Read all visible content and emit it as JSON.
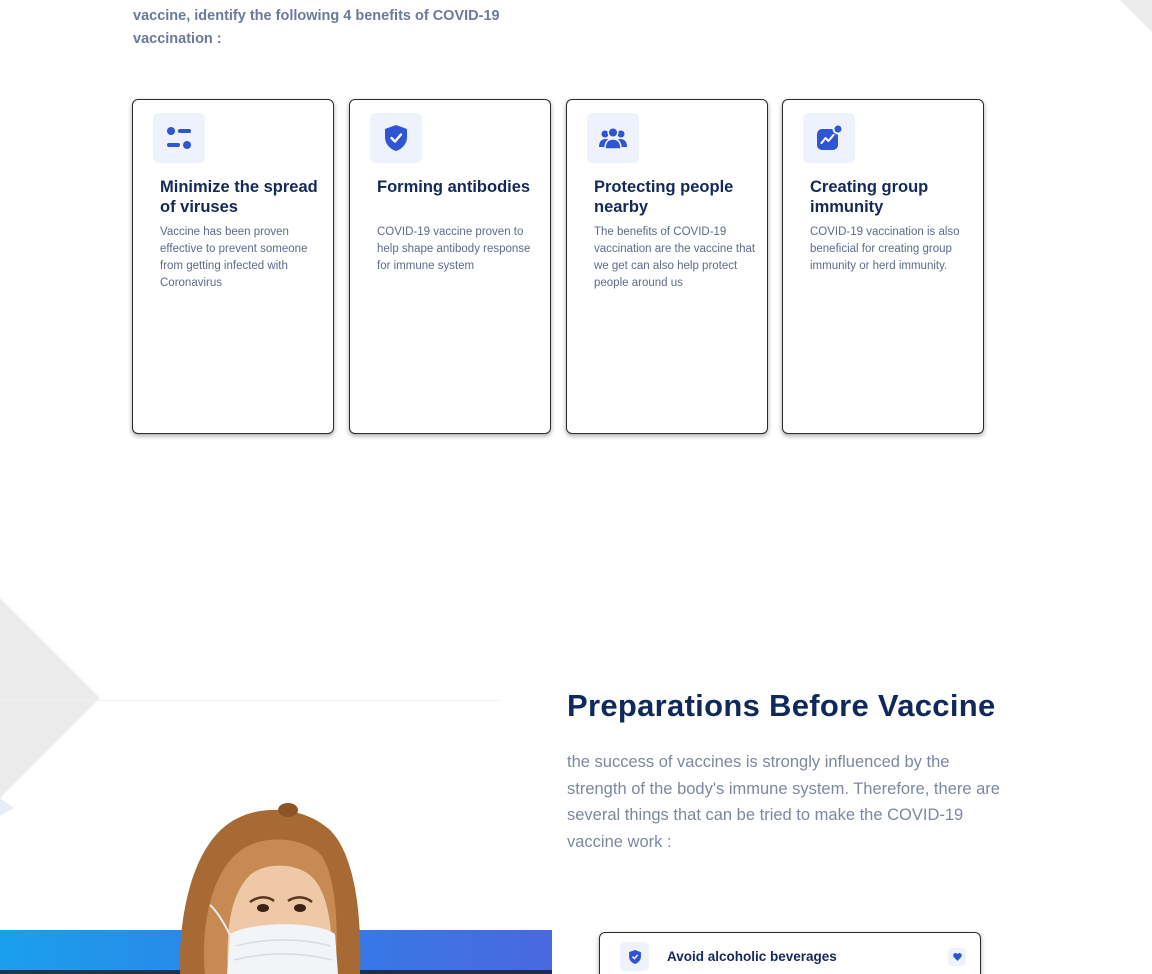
{
  "intro": {
    "text": "vaccine, identify the following 4 benefits of COVID-19 vaccination :"
  },
  "benefits": [
    {
      "icon": "sliders-icon",
      "title": "Minimize the spread of viruses",
      "text": "Vaccine has been proven effective to prevent someone from getting infected with Coronavirus"
    },
    {
      "icon": "shield-check-icon",
      "title": "Forming antibodies",
      "text": "COVID-19 vaccine proven to help shape antibody response for immune system"
    },
    {
      "icon": "people-icon",
      "title": "Protecting people nearby",
      "text": "The benefits of COVID-19 vaccination are the vaccine that we get can also help protect people around us"
    },
    {
      "icon": "chart-trend-icon",
      "title": "Creating group immunity",
      "text": "COVID-19 vaccination is also beneficial for creating group immunity or herd immunity."
    }
  ],
  "preparations": {
    "title": "Preparations Before Vaccine",
    "text": "the success of vaccines is strongly influenced by the strength of the body's immune system. Therefore, there are several things that can be tried to make the COVID-19 vaccine work :",
    "items": [
      {
        "icon": "shield-icon",
        "label": "Avoid alcoholic beverages"
      }
    ]
  },
  "colors": {
    "heading": "#10295c",
    "accent": "#2f55d4",
    "muted_text": "#7d889e"
  }
}
